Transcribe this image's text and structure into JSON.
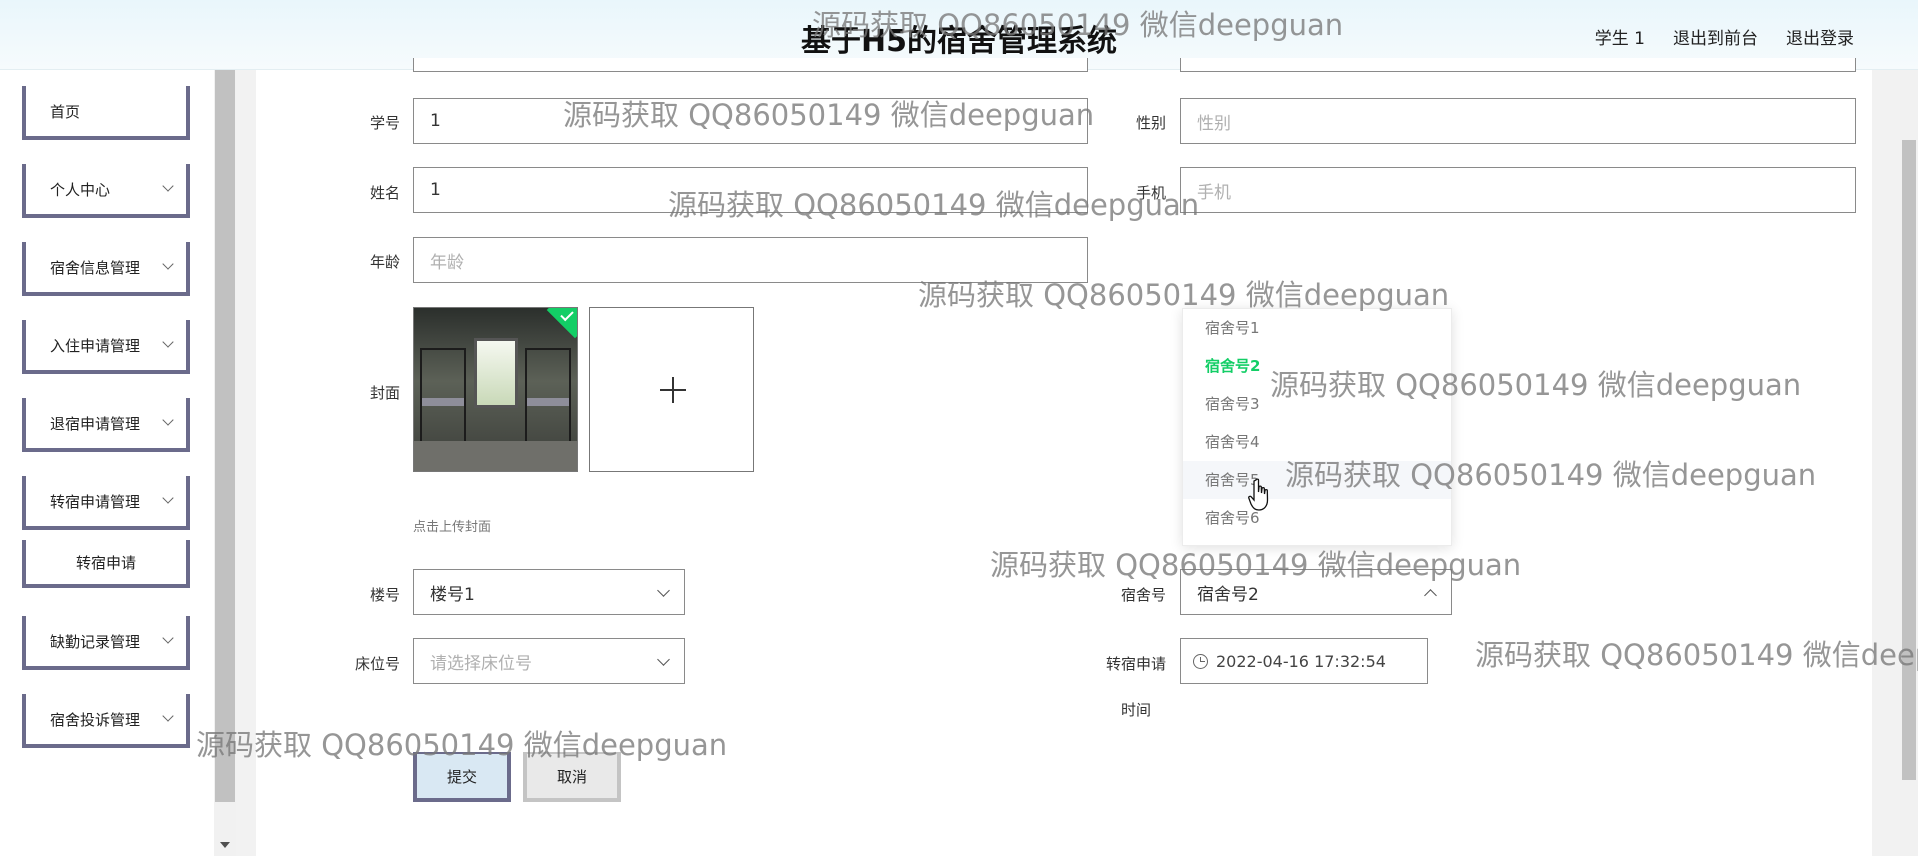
{
  "header": {
    "title": "基于H5的宿舍管理系统",
    "links": [
      "学生 1",
      "退出到前台",
      "退出登录"
    ]
  },
  "sidebar": {
    "items": [
      {
        "label": "首页",
        "has_chevron": false
      },
      {
        "label": "个人中心",
        "has_chevron": true
      },
      {
        "label": "宿舍信息管理",
        "has_chevron": true
      },
      {
        "label": "入住申请管理",
        "has_chevron": true
      },
      {
        "label": "退宿申请管理",
        "has_chevron": true
      },
      {
        "label": "转宿申请管理",
        "has_chevron": true
      },
      {
        "label": "转宿申请",
        "sub": true
      },
      {
        "label": "缺勤记录管理",
        "has_chevron": true
      },
      {
        "label": "宿舍投诉管理",
        "has_chevron": true
      }
    ]
  },
  "form": {
    "student_id": {
      "label": "学号",
      "value": "1"
    },
    "gender": {
      "label": "性别",
      "placeholder": "性别"
    },
    "name": {
      "label": "姓名",
      "value": "1"
    },
    "phone": {
      "label": "手机",
      "placeholder": "手机"
    },
    "age": {
      "label": "年龄",
      "placeholder": "年龄"
    },
    "cover": {
      "label": "封面",
      "hint": "点击上传封面"
    },
    "building": {
      "label": "楼号",
      "value": "楼号1"
    },
    "room": {
      "label": "宿舍号",
      "value": "宿舍号2"
    },
    "bed": {
      "label": "床位号",
      "placeholder": "请选择床位号"
    },
    "transfer_time": {
      "label_line1": "转宿申请",
      "label_line2": "时间",
      "value": "2022-04-16 17:32:54"
    },
    "submit_label": "提交",
    "cancel_label": "取消"
  },
  "room_dropdown": {
    "options": [
      "宿舍号1",
      "宿舍号2",
      "宿舍号3",
      "宿舍号4",
      "宿舍号5",
      "宿舍号6"
    ],
    "selected": "宿舍号2",
    "hovered": "宿舍号5"
  },
  "watermark": {
    "text": "源码获取 QQ86050149 微信deepguan"
  },
  "colors": {
    "accent_green": "#13ce66",
    "sidebar_border": "#6b6b8b",
    "header_bg": "#e9f6fb"
  }
}
